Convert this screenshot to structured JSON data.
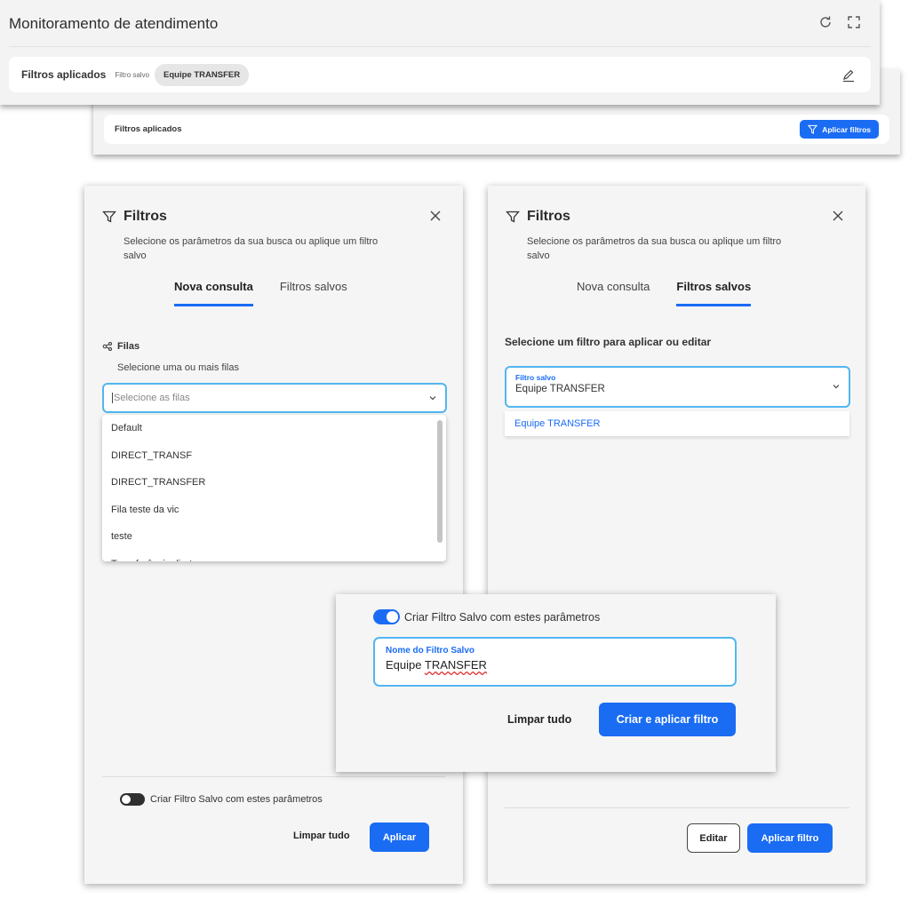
{
  "top_panel": {
    "title": "Monitoramento de atendimento",
    "filters_label": "Filtros aplicados",
    "saved_filter_label": "Filtro salvo",
    "chip": "Equipe TRANSFER"
  },
  "second_panel": {
    "filters_label": "Filtros aplicados",
    "apply_button": "Aplicar filtros"
  },
  "left_modal": {
    "title": "Filtros",
    "subtitle": "Selecione os parâmetros da sua busca ou aplique um filtro salvo",
    "tabs": [
      {
        "label": "Nova consulta"
      },
      {
        "label": "Filtros salvos"
      }
    ],
    "active_tab": "Nova consulta",
    "section_label": "Filas",
    "section_help": "Selecione uma ou mais filas",
    "select_placeholder": "Selecione as filas",
    "options": [
      {
        "label": "Default"
      },
      {
        "label": "DIRECT_TRANSF"
      },
      {
        "label": "DIRECT_TRANSFER"
      },
      {
        "label": "Fila teste da vic"
      },
      {
        "label": "teste"
      },
      {
        "label": "Transferência direta"
      }
    ],
    "toggle_label": "Criar Filtro Salvo com estes parâmetros",
    "toggle_on": false,
    "clear_button": "Limpar tudo",
    "apply_button": "Aplicar"
  },
  "right_modal": {
    "title": "Filtros",
    "subtitle": "Selecione os parâmetros da sua busca ou aplique um filtro salvo",
    "tabs": [
      {
        "label": "Nova consulta"
      },
      {
        "label": "Filtros salvos"
      }
    ],
    "active_tab": "Filtros salvos",
    "heading": "Selecione um filtro para aplicar ou editar",
    "select_caption": "Filtro salvo",
    "select_value": "Equipe TRANSFER",
    "option": "Equipe TRANSFER",
    "edit_button": "Editar",
    "apply_button": "Aplicar filtro"
  },
  "save_panel": {
    "toggle_label": "Criar Filtro Salvo com estes parâmetros",
    "toggle_on": true,
    "field_caption": "Nome do Filtro Salvo",
    "field_value_word1": "Equipe",
    "field_value_word2": "TRANSFER",
    "clear_button": "Limpar tudo",
    "create_button": "Criar e aplicar filtro"
  },
  "colors": {
    "accent": "#1a6cf3",
    "focus_border": "#52b6f0",
    "panel_bg": "#f5f5f5"
  },
  "icons": [
    "refresh-icon",
    "fullscreen-icon",
    "pencil-icon",
    "filter-icon",
    "close-icon",
    "queue-icon",
    "chevron-down-icon"
  ]
}
